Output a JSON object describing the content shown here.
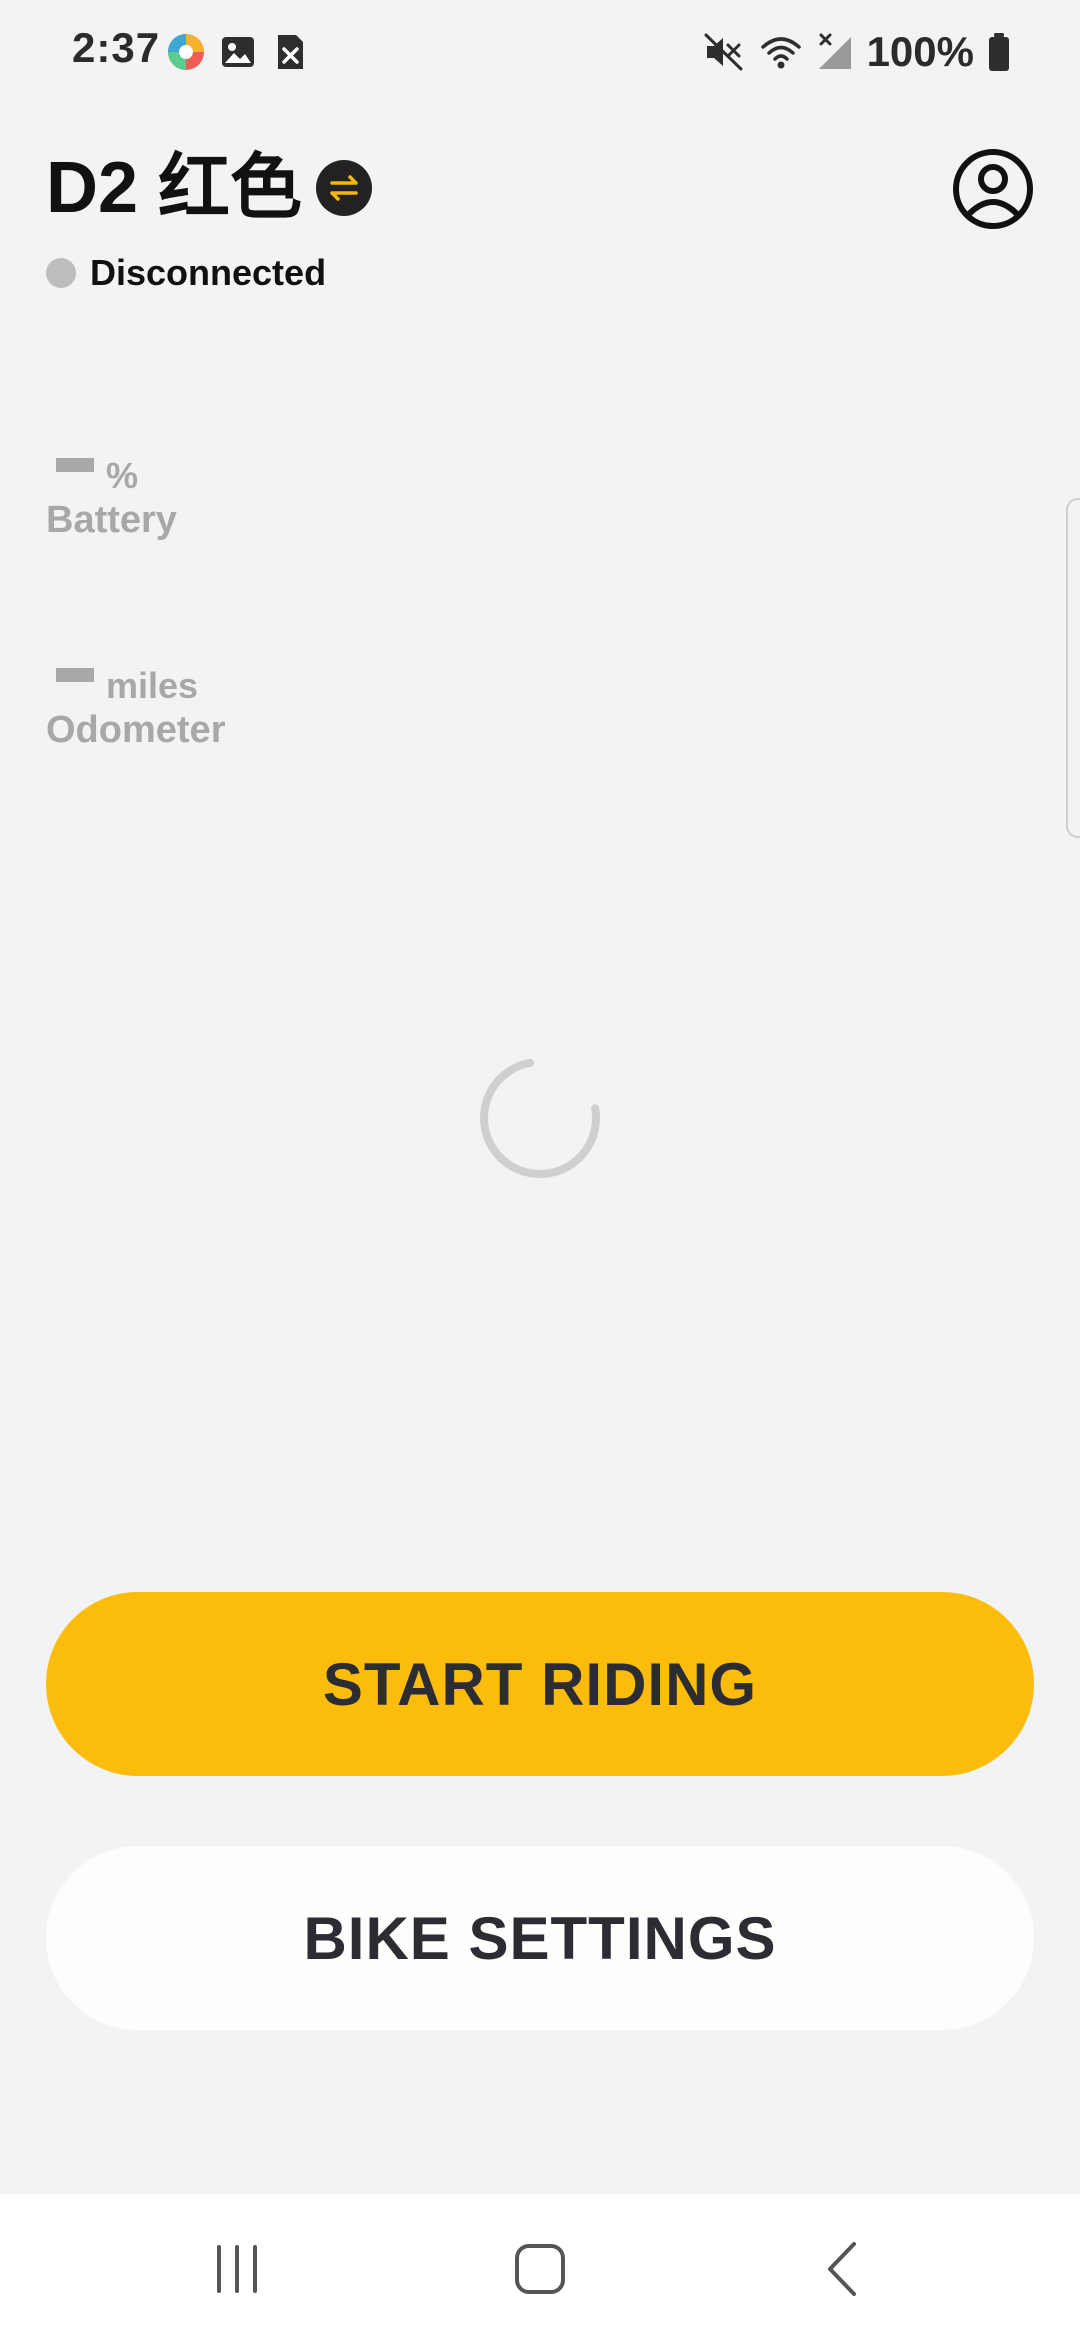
{
  "status_bar": {
    "time": "2:37",
    "battery_percent": "100%",
    "notification_icons": [
      "photos-app-icon",
      "gallery-icon",
      "close-notification-icon"
    ],
    "system_icons": [
      "mute-icon",
      "wifi-icon",
      "no-signal-icon",
      "battery-icon"
    ]
  },
  "header": {
    "bike_name": "D2 红色",
    "connection_status": "Disconnected",
    "swap_icon": "swap-icon",
    "profile_icon": "account-icon"
  },
  "stats": {
    "battery": {
      "value": "—",
      "unit": "%",
      "label": "Battery"
    },
    "odometer": {
      "value": "—",
      "unit": "miles",
      "label": "Odometer"
    }
  },
  "actions": {
    "start_riding": "START RIDING",
    "bike_settings": "BIKE SETTINGS"
  },
  "colors": {
    "background": "#f2f3f5",
    "accent": "#fcbc0c",
    "secondary_button": "#fdfdfb",
    "muted_text": "#a8a8a8",
    "status_dot": "#bdbdbd"
  },
  "nav_bar": {
    "buttons": [
      "recents-icon",
      "home-icon",
      "back-icon"
    ]
  }
}
